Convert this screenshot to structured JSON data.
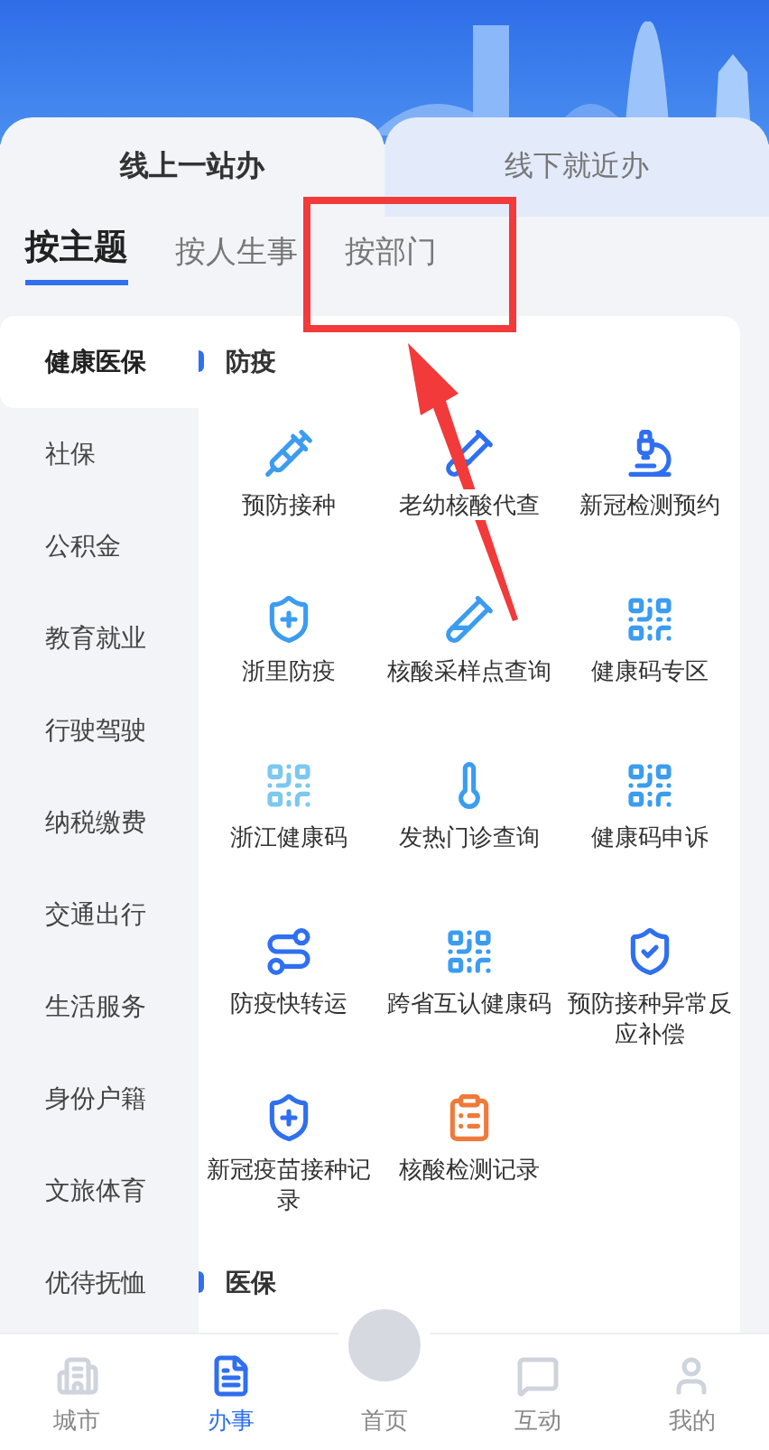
{
  "top_tabs": [
    {
      "label": "线上一站办",
      "selected": true
    },
    {
      "label": "线下就近办",
      "selected": false
    }
  ],
  "sub_tabs": [
    {
      "label": "按主题",
      "selected": true
    },
    {
      "label": "按人生事",
      "selected": false
    },
    {
      "label": "按部门",
      "selected": false
    }
  ],
  "sidebar": {
    "items": [
      {
        "label": "健康医保",
        "selected": true
      },
      {
        "label": "社保",
        "selected": false
      },
      {
        "label": "公积金",
        "selected": false
      },
      {
        "label": "教育就业",
        "selected": false
      },
      {
        "label": "行驶驾驶",
        "selected": false
      },
      {
        "label": "纳税缴费",
        "selected": false
      },
      {
        "label": "交通出行",
        "selected": false
      },
      {
        "label": "生活服务",
        "selected": false
      },
      {
        "label": "身份户籍",
        "selected": false
      },
      {
        "label": "文旅体育",
        "selected": false
      },
      {
        "label": "优待抚恤",
        "selected": false
      }
    ]
  },
  "sections": [
    {
      "title": "防疫",
      "services": [
        {
          "label": "预防接种"
        },
        {
          "label": "老幼核酸代查"
        },
        {
          "label": "新冠检测预约"
        },
        {
          "label": "浙里防疫"
        },
        {
          "label": "核酸采样点查询"
        },
        {
          "label": "健康码专区"
        },
        {
          "label": "浙江健康码"
        },
        {
          "label": "发热门诊查询"
        },
        {
          "label": "健康码申诉"
        },
        {
          "label": "防疫快转运"
        },
        {
          "label": "跨省互认健康码"
        },
        {
          "label": "预防接种异常反应补偿"
        },
        {
          "label": "新冠疫苗接种记录"
        },
        {
          "label": "核酸检测记录"
        }
      ]
    },
    {
      "title": "医保"
    }
  ],
  "bottom_nav": [
    {
      "label": "城市",
      "selected": false
    },
    {
      "label": "办事",
      "selected": true
    },
    {
      "label": "首页",
      "selected": false
    },
    {
      "label": "互动",
      "selected": false
    },
    {
      "label": "我的",
      "selected": false
    }
  ]
}
